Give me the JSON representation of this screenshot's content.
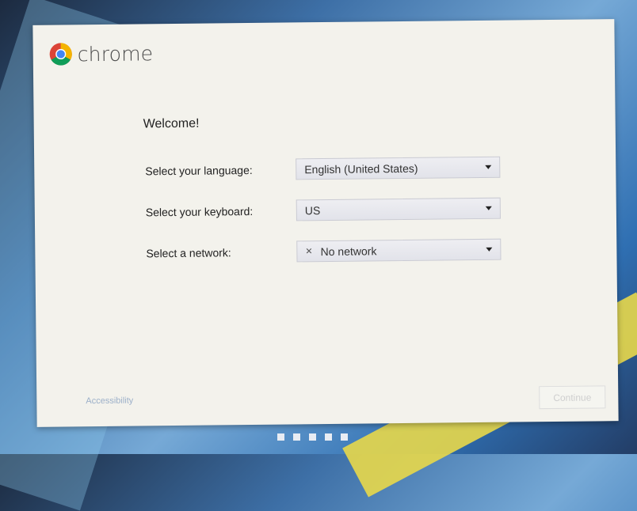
{
  "app": {
    "brand": "chrome"
  },
  "welcome": "Welcome!",
  "fields": {
    "language": {
      "label": "Select your language:",
      "value": "English (United States)"
    },
    "keyboard": {
      "label": "Select your keyboard:",
      "value": "US"
    },
    "network": {
      "label": "Select a network:",
      "value": "No network",
      "icon": "x-icon"
    }
  },
  "footer": {
    "accessibility": "Accessibility",
    "continue": "Continue"
  },
  "colors": {
    "dialog_bg": "#f3f2ec",
    "chrome_red": "#db4437",
    "chrome_green": "#0f9d58",
    "chrome_yellow": "#f4b400",
    "chrome_blue": "#4285f4"
  },
  "progress_dots": 5
}
